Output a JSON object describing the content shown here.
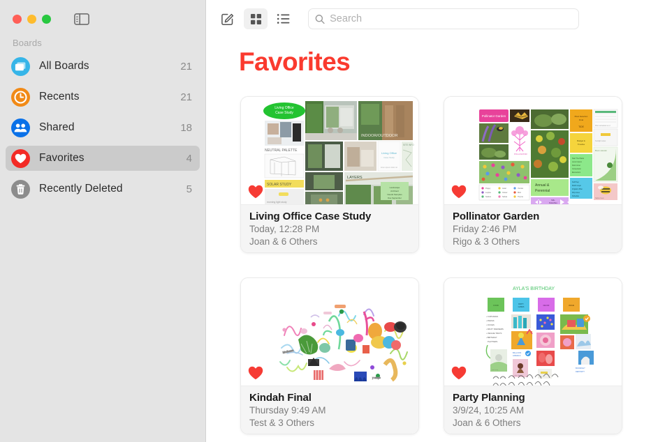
{
  "window": {
    "traffic_lights": [
      "close",
      "minimize",
      "maximize"
    ],
    "sidebar_toggle_icon": "sidebar-toggle-icon"
  },
  "sidebar": {
    "section_label": "Boards",
    "items": [
      {
        "label": "All Boards",
        "count": "21",
        "icon": "boards-icon",
        "color": "#36b5e8",
        "selected": false
      },
      {
        "label": "Recents",
        "count": "21",
        "icon": "clock-icon",
        "color": "#f18a16",
        "selected": false
      },
      {
        "label": "Shared",
        "count": "18",
        "icon": "people-icon",
        "color": "#0a71e8",
        "selected": false
      },
      {
        "label": "Favorites",
        "count": "4",
        "icon": "heart-icon",
        "color": "#f32b26",
        "selected": true
      },
      {
        "label": "Recently Deleted",
        "count": "5",
        "icon": "trash-icon",
        "color": "#868686",
        "selected": false
      }
    ]
  },
  "toolbar": {
    "compose_label": "compose-icon",
    "grid_view_label": "grid-view-icon",
    "list_view_label": "list-view-icon",
    "grid_view_selected": true,
    "search_placeholder": "Search",
    "search_value": ""
  },
  "main": {
    "title": "Favorites",
    "title_color": "#fa3a2e",
    "cards": [
      {
        "title": "Living Office Case Study",
        "date": "Today, 12:28 PM",
        "people": "Joan & 6 Others",
        "favorite": true,
        "thumb_labels": [
          "Living Office Case Study",
          "INDOOR/OUTDOOR",
          "NEUTRAL PALETTE",
          "SOLAR STUDY",
          "LAYERS"
        ]
      },
      {
        "title": "Pollinator Garden",
        "date": "Friday 2:46 PM",
        "people": "Rigo & 3 Others",
        "favorite": true,
        "thumb_labels": [
          "Pollinator Garden",
          "Annual & Perennial"
        ]
      },
      {
        "title": "Kindah Final",
        "date": "Thursday 9:49 AM",
        "people": "Test & 3 Others",
        "favorite": true,
        "thumb_labels": []
      },
      {
        "title": "Party Planning",
        "date": "3/9/24, 10:25 AM",
        "people": "Joan & 6 Others",
        "favorite": true,
        "thumb_labels": [
          "AYLA'S BIRTHDAY"
        ]
      }
    ]
  }
}
